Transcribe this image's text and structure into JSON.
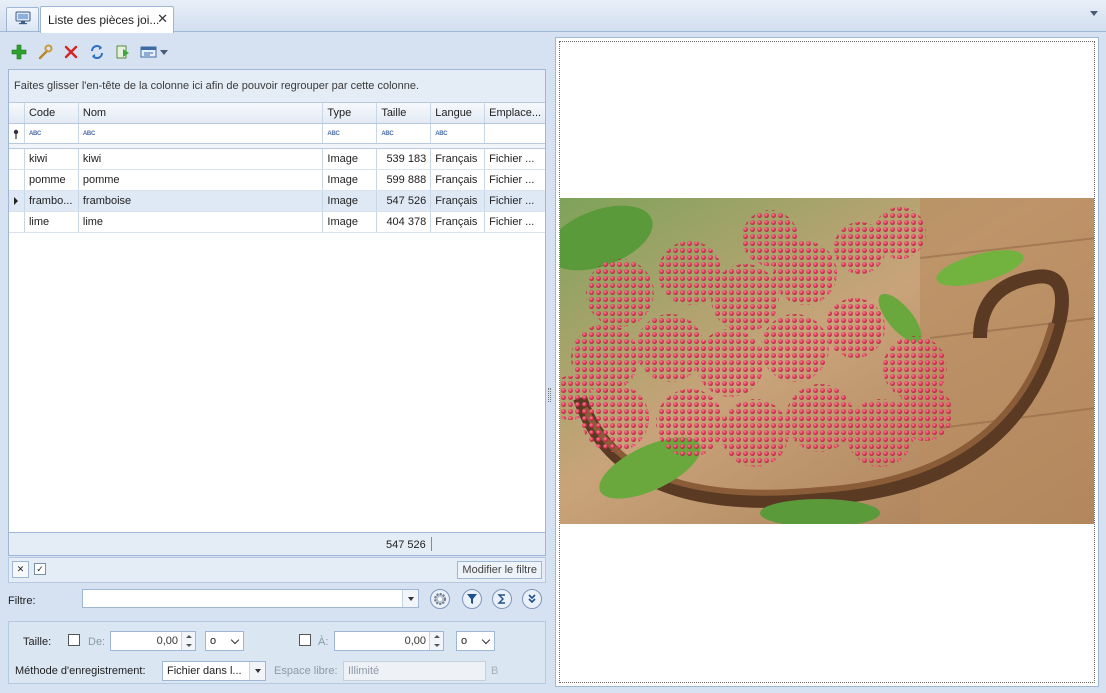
{
  "tabs": {
    "home_icon": "monitor-icon",
    "active_label": "Liste des pièces joi...",
    "close_glyph": "✕"
  },
  "toolbar": {
    "buttons": [
      "add-icon",
      "edit-wrench-icon",
      "delete-icon",
      "refresh-icon",
      "run-icon",
      "view-options-icon"
    ]
  },
  "grid": {
    "group_hint": "Faites glisser l'en-tête de la colonne ici afin de pouvoir regrouper par cette colonne.",
    "columns": [
      "Code",
      "Nom",
      "Type",
      "Taille",
      "Langue",
      "Emplace..."
    ],
    "filter_row_hint": "ABC",
    "rows": [
      {
        "code": "kiwi",
        "nom": "kiwi",
        "type": "Image",
        "taille": "539 183",
        "langue": "Français",
        "emplacement": "Fichier ..."
      },
      {
        "code": "pomme",
        "nom": "pomme",
        "type": "Image",
        "taille": "599 888",
        "langue": "Français",
        "emplacement": "Fichier ..."
      },
      {
        "code": "frambo...",
        "nom": "framboise",
        "type": "Image",
        "taille": "547 526",
        "langue": "Français",
        "emplacement": "Fichier ..."
      },
      {
        "code": "lime",
        "nom": "lime",
        "type": "Image",
        "taille": "404 378",
        "langue": "Français",
        "emplacement": "Fichier ..."
      }
    ],
    "selected_row_index": 2,
    "footer_sum": "547 526"
  },
  "filterbar": {
    "clear_glyph": "✕",
    "check_glyph": "✓",
    "modify_label": "Modifier le filtre"
  },
  "filter": {
    "label": "Filtre:",
    "value": ""
  },
  "options": {
    "taille_label": "Taille:",
    "de_label": "De:",
    "de_value": "0,00",
    "de_unit": "o",
    "a_label": "À:",
    "a_value": "0,00",
    "a_unit": "o",
    "methode_label": "Méthode d'enregistrement:",
    "methode_value": "Fichier dans l...",
    "espace_label": "Espace libre:",
    "espace_value": "Illimité",
    "espace_unit": "B"
  },
  "colors": {
    "accent": "#9fb6d4",
    "selected_row": "#dfe9f6",
    "background": "#d6e2f1"
  }
}
